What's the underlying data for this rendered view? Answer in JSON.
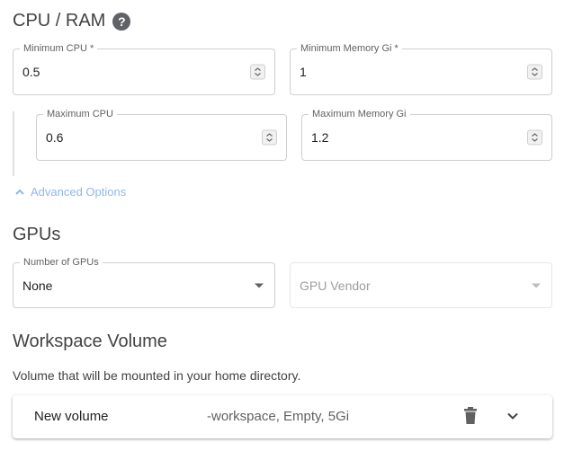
{
  "cpu_ram": {
    "title": "CPU / RAM",
    "help_icon": "help-icon",
    "min_cpu": {
      "label": "Minimum CPU *",
      "value": "0.5"
    },
    "min_memory": {
      "label": "Minimum Memory Gi *",
      "value": "1"
    },
    "max_cpu": {
      "label": "Maximum CPU",
      "value": "0.6"
    },
    "max_memory": {
      "label": "Maximum Memory Gi",
      "value": "1.2"
    },
    "advanced_label": "Advanced Options"
  },
  "gpus": {
    "title": "GPUs",
    "number": {
      "label": "Number of GPUs",
      "value": "None"
    },
    "vendor": {
      "placeholder": "GPU Vendor"
    }
  },
  "workspace": {
    "title": "Workspace Volume",
    "description": "Volume that will be mounted in your home directory.",
    "volume": {
      "name": "New volume",
      "details": "-workspace, Empty, 5Gi"
    }
  },
  "colors": {
    "accent_light": "#90b6ee",
    "border": "#cfcfcf"
  }
}
